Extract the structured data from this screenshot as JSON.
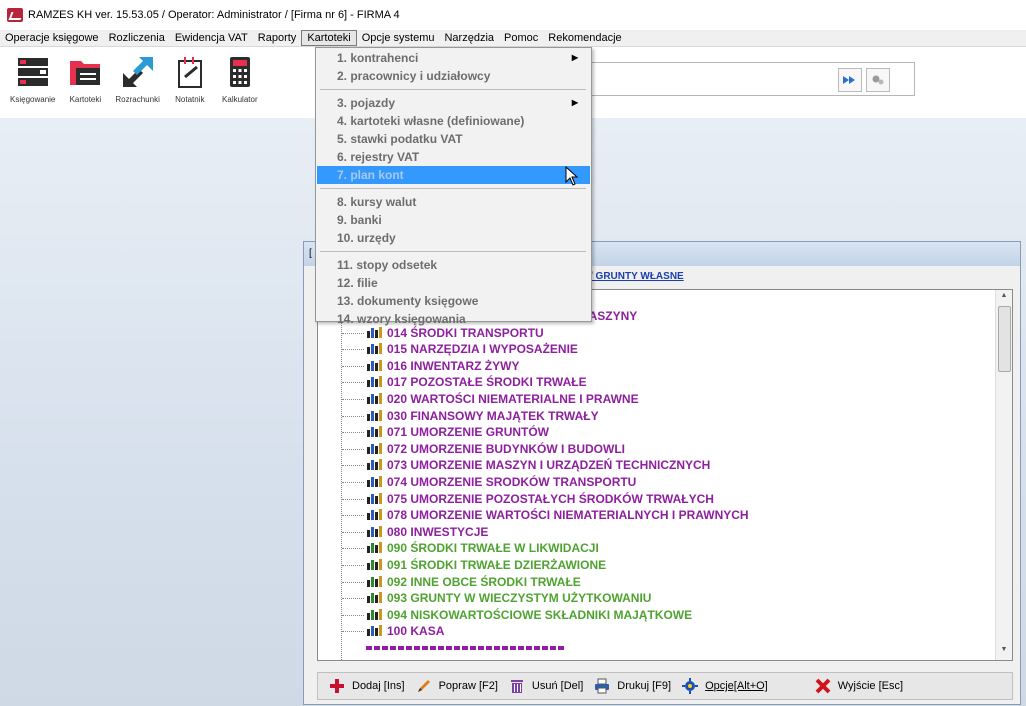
{
  "app": {
    "title": "RAMZES KH ver. 15.53.05 /  Operator: Administrator /  [Firma nr 6] - FIRMA 4"
  },
  "menubar": [
    {
      "label": "Operacje księgowe"
    },
    {
      "label": "Rozliczenia"
    },
    {
      "label": "Ewidencja VAT"
    },
    {
      "label": "Raporty"
    },
    {
      "label": "Kartoteki",
      "active": true
    },
    {
      "label": "Opcje systemu"
    },
    {
      "label": "Narzędzia"
    },
    {
      "label": "Pomoc"
    },
    {
      "label": "Rekomendacje"
    }
  ],
  "toolbar": [
    {
      "label": "Księgowanie",
      "icon": "ledger-icon"
    },
    {
      "label": "Kartoteki",
      "icon": "folder-icon"
    },
    {
      "label": "Rozrachunki",
      "icon": "arrows-icon"
    },
    {
      "label": "Notatnik",
      "icon": "notepad-icon"
    },
    {
      "label": "Kalkulator",
      "icon": "calculator-icon"
    }
  ],
  "dropdown": {
    "items": [
      {
        "label": "1. kontrahenci",
        "submenu": true
      },
      {
        "label": "2. pracownicy i udziałowcy"
      },
      {
        "sep": true
      },
      {
        "label": "3. pojazdy",
        "submenu": true
      },
      {
        "label": "4. kartoteki własne (definiowane)"
      },
      {
        "label": "5. stawki podatku VAT"
      },
      {
        "label": "6. rejestry VAT"
      },
      {
        "label": "7. plan kont",
        "highlighted": true
      },
      {
        "sep": true
      },
      {
        "label": "8. kursy walut"
      },
      {
        "label": "9. banki"
      },
      {
        "label": "10. urzędy"
      },
      {
        "sep": true
      },
      {
        "label": "11. stopy odsetek"
      },
      {
        "label": "12. filie"
      },
      {
        "label": "13. dokumenty księgowe"
      },
      {
        "label": "14. wzory księgowania"
      }
    ]
  },
  "inner_window": {
    "breadcrumb": "/ GRUNTY WŁASNE",
    "accounts": [
      {
        "label": "013 URZĄDZENIA TECHNICZNE I MASZYNY",
        "color": "#8e1f9e",
        "kind": "asset"
      },
      {
        "label": "014 ŚRODKI TRANSPORTU",
        "color": "#8e1f9e",
        "kind": "asset"
      },
      {
        "label": "015 NARZĘDZIA I WYPOSAŻENIE",
        "color": "#8e1f9e",
        "kind": "asset"
      },
      {
        "label": "016 INWENTARZ ŻYWY",
        "color": "#8e1f9e",
        "kind": "asset"
      },
      {
        "label": "017 POZOSTAŁE ŚRODKI TRWAŁE",
        "color": "#8e1f9e",
        "kind": "asset"
      },
      {
        "label": "020 WARTOŚCI NIEMATERIALNE I PRAWNE",
        "color": "#8e1f9e",
        "kind": "asset"
      },
      {
        "label": "030 FINANSOWY MAJĄTEK TRWAŁY",
        "color": "#8e1f9e",
        "kind": "asset"
      },
      {
        "label": "071 UMORZENIE GRUNTÓW",
        "color": "#8e1f9e",
        "kind": "asset"
      },
      {
        "label": "072 UMORZENIE BUDYNKÓW I BUDOWLI",
        "color": "#8e1f9e",
        "kind": "asset"
      },
      {
        "label": "073 UMORZENIE MASZYN I URZĄDZEŃ TECHNICZNYCH",
        "color": "#8e1f9e",
        "kind": "asset"
      },
      {
        "label": "074 UMORZENIE SRODKÓW TRANSPORTU",
        "color": "#8e1f9e",
        "kind": "asset"
      },
      {
        "label": "075 UMORZENIE POZOSTAŁYCH ŚRODKÓW TRWAŁYCH",
        "color": "#8e1f9e",
        "kind": "asset"
      },
      {
        "label": "078 UMORZENIE WARTOŚCI NIEMATERIALNYCH I PRAWNYCH",
        "color": "#8e1f9e",
        "kind": "asset"
      },
      {
        "label": "080 INWESTYCJE",
        "color": "#8e1f9e",
        "kind": "asset"
      },
      {
        "label": "090 ŚRODKI TRWAŁE W LIKWIDACJI",
        "color": "#4fa331",
        "kind": "offbalance"
      },
      {
        "label": "091 ŚRODKI TRWAŁE DZIERŻAWIONE",
        "color": "#4fa331",
        "kind": "offbalance"
      },
      {
        "label": "092 INNE OBCE ŚRODKI TRWAŁE",
        "color": "#4fa331",
        "kind": "offbalance"
      },
      {
        "label": "093 GRUNTY W WIECZYSTYM UŻYTKOWANIU",
        "color": "#4fa331",
        "kind": "offbalance"
      },
      {
        "label": "094 NISKOWARTOŚCIOWE SKŁADNIKI MAJĄTKOWE",
        "color": "#4fa331",
        "kind": "offbalance"
      },
      {
        "label": "100 KASA",
        "color": "#8e1f9e",
        "kind": "asset"
      }
    ]
  },
  "bottom_bar": [
    {
      "label": "Dodaj  [Ins]",
      "icon": "plus-icon",
      "color": "#c8102e"
    },
    {
      "label": "Popraw  [F2]",
      "icon": "pencil-icon",
      "color": "#e07a1a"
    },
    {
      "label": "Usuń  [Del]",
      "icon": "trash-icon",
      "color": "#7b3fa0"
    },
    {
      "label": "Drukuj  [F9]",
      "icon": "printer-icon",
      "color": "#2d5fa8"
    },
    {
      "label": "Opcje[Alt+O]",
      "icon": "gear-icon",
      "color": "#1a4fb5"
    },
    {
      "label": "Wyjście  [Esc]",
      "icon": "close-icon",
      "color": "#d0141c"
    }
  ]
}
